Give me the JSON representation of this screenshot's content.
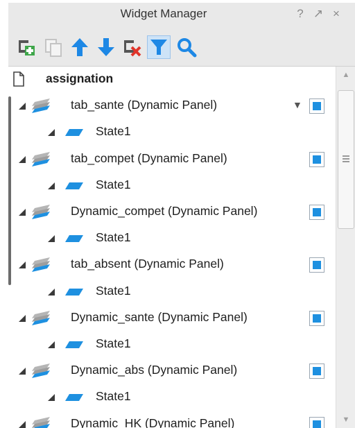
{
  "window": {
    "title": "Widget Manager",
    "help_glyph": "?",
    "pin_glyph": "↗",
    "close_glyph": "×"
  },
  "toolbar": {
    "tools": [
      {
        "name": "add-state",
        "icon": "add-folder-icon"
      },
      {
        "name": "duplicate",
        "icon": "copy-icon"
      },
      {
        "name": "move-up",
        "icon": "arrow-up-icon"
      },
      {
        "name": "move-down",
        "icon": "arrow-down-icon"
      },
      {
        "name": "delete",
        "icon": "delete-icon"
      },
      {
        "name": "filter",
        "icon": "filter-icon",
        "active": true
      },
      {
        "name": "search",
        "icon": "search-icon"
      }
    ]
  },
  "tree": {
    "root": {
      "label": "assignation",
      "icon": "page-icon"
    },
    "panels": [
      {
        "label": "tab_sante (Dynamic Panel)",
        "visible": true,
        "has_dropdown": true,
        "states": [
          "State1"
        ]
      },
      {
        "label": "tab_compet (Dynamic Panel)",
        "visible": true,
        "states": [
          "State1"
        ]
      },
      {
        "label": "Dynamic_compet (Dynamic Panel)",
        "visible": true,
        "states": [
          "State1"
        ]
      },
      {
        "label": "tab_absent (Dynamic Panel)",
        "visible": true,
        "states": [
          "State1"
        ]
      },
      {
        "label": "Dynamic_sante (Dynamic Panel)",
        "visible": true,
        "states": [
          "State1"
        ]
      },
      {
        "label": "Dynamic_abs (Dynamic Panel)",
        "visible": true,
        "states": [
          "State1"
        ]
      },
      {
        "label": "Dynamic_HK (Dynamic Panel)",
        "visible": true,
        "states": []
      }
    ]
  },
  "colors": {
    "accent": "#1e90e0",
    "toolbar_bg": "#e9e9e9",
    "filter_active_bg": "#cde3f7"
  }
}
